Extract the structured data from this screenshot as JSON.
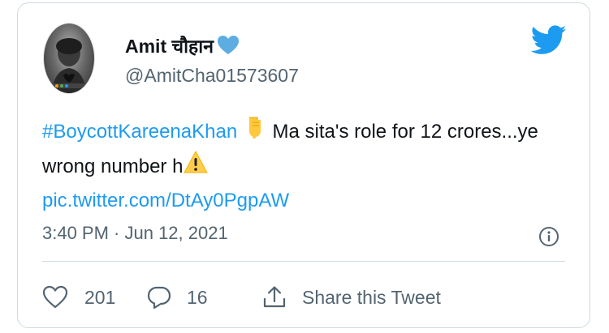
{
  "tweet": {
    "display_name": "Amit चौहान",
    "handle": "@AmitCha01573607",
    "hashtag": "#BoycottKareenaKhan",
    "text_part1": " Ma sita's role for 12 crores...ye wrong number h",
    "link": "pic.twitter.com/DtAy0PgpAW",
    "timestamp": "3:40 PM · Jun 12, 2021"
  },
  "actions": {
    "likes": "201",
    "replies": "16",
    "share_label": "Share this Tweet"
  },
  "icons": {
    "name_emoji": "blue-heart-icon",
    "pointing_emoji": "pointing-down-icon",
    "warning_emoji": "warning-icon",
    "brand": "twitter-bird-icon",
    "info": "info-icon",
    "like": "heart-outline-icon",
    "reply": "reply-bubble-icon",
    "share": "share-icon"
  },
  "colors": {
    "link": "#1d9bf0",
    "muted": "#536471",
    "border": "#cfd9de",
    "heart_blue": "#5dade2"
  }
}
